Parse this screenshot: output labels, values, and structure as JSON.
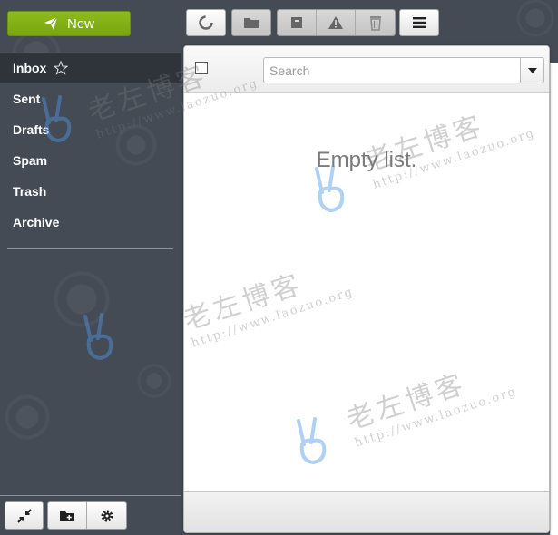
{
  "compose": {
    "label": "New"
  },
  "folders": [
    {
      "label": "Inbox",
      "active": true
    },
    {
      "label": "Sent"
    },
    {
      "label": "Drafts"
    },
    {
      "label": "Spam"
    },
    {
      "label": "Trash"
    },
    {
      "label": "Archive"
    }
  ],
  "list": {
    "search_placeholder": "Search",
    "empty_text": "Empty list."
  },
  "watermark": {
    "title": "老左博客",
    "url": "http://www.laozuo.org"
  },
  "colors": {
    "accent": "#8dbb1c",
    "sidebar_bg": "#444b55",
    "active_folder": "#2f343b"
  }
}
